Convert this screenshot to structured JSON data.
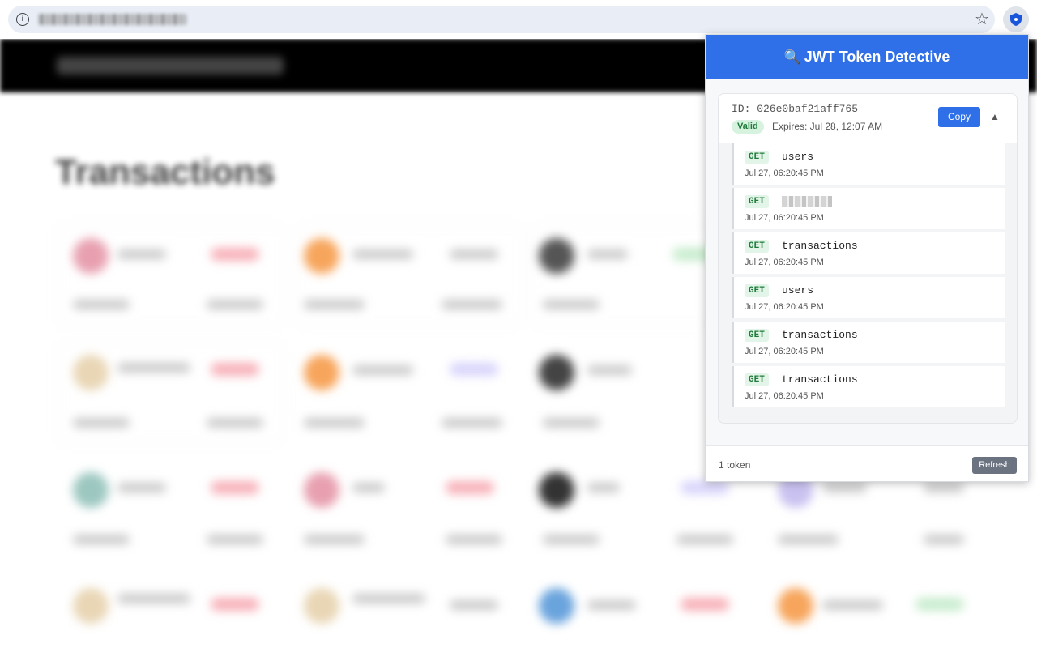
{
  "browser": {
    "url_icon": "info-icon",
    "bookmark_icon": "star-icon",
    "extension_icon": "shield-icon"
  },
  "page": {
    "title": "Transactions"
  },
  "popup": {
    "title": "JWT Token Detective",
    "title_icon": "magnifier-icon",
    "token": {
      "id_label": "ID: 026e0baf21aff765",
      "status": "Valid",
      "expires": "Expires: Jul 28, 12:07 AM",
      "copy_label": "Copy",
      "collapse_glyph": "▲"
    },
    "requests": [
      {
        "method": "GET",
        "path": "users",
        "time": "Jul 27, 06:20:45 PM",
        "redacted": false
      },
      {
        "method": "GET",
        "path": "",
        "time": "Jul 27, 06:20:45 PM",
        "redacted": true
      },
      {
        "method": "GET",
        "path": "transactions",
        "time": "Jul 27, 06:20:45 PM",
        "redacted": false
      },
      {
        "method": "GET",
        "path": "users",
        "time": "Jul 27, 06:20:45 PM",
        "redacted": false
      },
      {
        "method": "GET",
        "path": "transactions",
        "time": "Jul 27, 06:20:45 PM",
        "redacted": false
      },
      {
        "method": "GET",
        "path": "transactions",
        "time": "Jul 27, 06:20:45 PM",
        "redacted": false
      }
    ],
    "footer": {
      "count": "1 token",
      "refresh_label": "Refresh"
    },
    "colors": {
      "accent": "#2f6fe8",
      "valid_bg": "#d7f3df",
      "valid_fg": "#1e7b3a"
    }
  }
}
